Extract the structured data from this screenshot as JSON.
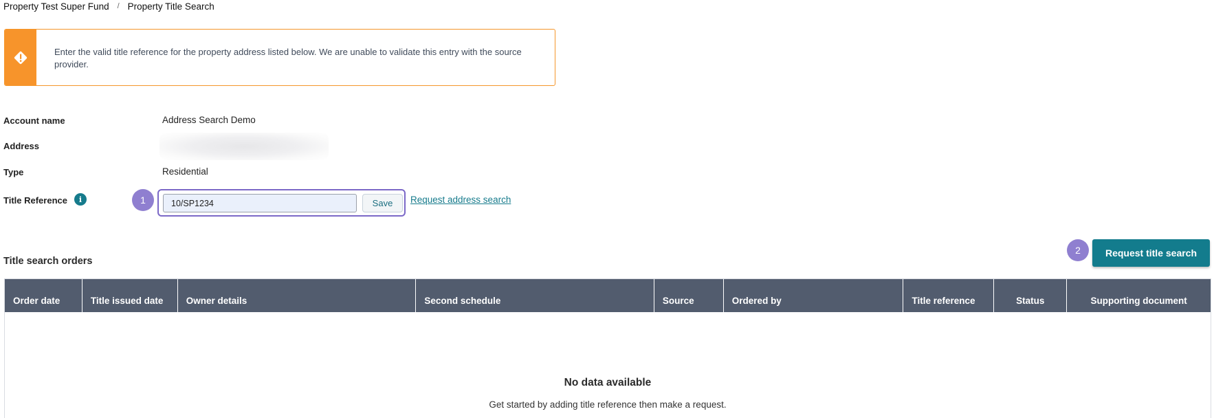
{
  "breadcrumb": {
    "items": [
      "Property Test Super Fund",
      "Property Title Search"
    ],
    "separator": "/"
  },
  "alert": {
    "message": "Enter the valid title reference for the property address listed below. We are unable to validate this entry with the source provider.",
    "icon": "warning-diamond-icon",
    "color": "#f7942b"
  },
  "details": {
    "account_name_label": "Account name",
    "account_name_value": "Address Search Demo",
    "address_label": "Address",
    "type_label": "Type",
    "type_value": "Residential",
    "title_reference_label": "Title Reference"
  },
  "title_reference": {
    "value": "10/SP1234",
    "save_label": "Save",
    "request_address_link": "Request address search"
  },
  "steps": [
    "1",
    "2"
  ],
  "orders": {
    "section_title": "Title search orders",
    "request_button": "Request title search",
    "columns": [
      "Order date",
      "Title issued date",
      "Owner details",
      "Second schedule",
      "Source",
      "Ordered by",
      "Title reference",
      "Status",
      "Supporting document"
    ],
    "empty_title": "No data available",
    "empty_subtitle": "Get started by adding title reference then make a request."
  },
  "colors": {
    "accent": "#137c8d",
    "header_bg": "#525c6e",
    "step_badge": "#8f7fd0",
    "highlight_border": "#7b68c7"
  }
}
